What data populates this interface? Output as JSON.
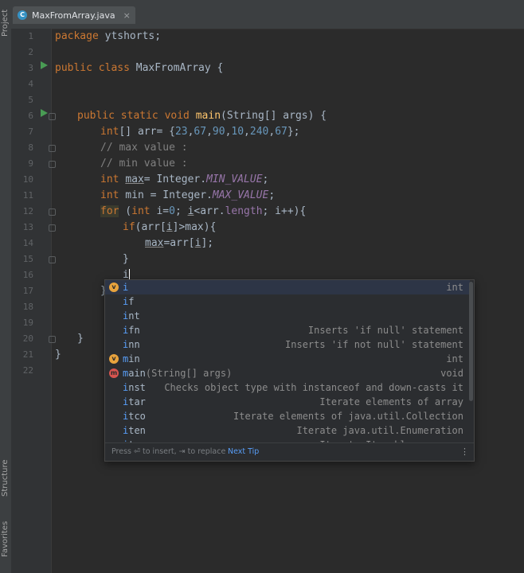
{
  "side_tools": {
    "project": "Project",
    "structure": "Structure",
    "favorites": "Favorites"
  },
  "tab": {
    "icon_letter": "C",
    "title": "MaxFromArray.java",
    "close": "×"
  },
  "line_numbers": [
    "1",
    "2",
    "3",
    "4",
    "5",
    "6",
    "7",
    "8",
    "9",
    "10",
    "11",
    "12",
    "13",
    "14",
    "15",
    "16",
    "17",
    "18",
    "19",
    "20",
    "21",
    "22"
  ],
  "code": {
    "l1_kw": "package",
    "l1_rest": " ytshorts;",
    "l3_kw": "public class",
    "l3_rest": " MaxFromArray {",
    "l6_kw": "public static void",
    "l6_fn": " main",
    "l6_rest": "(String[] args) {",
    "l7_kw": "int",
    "l7_a": "[] arr= {",
    "l7_n1": "23",
    "c": ",",
    "l7_n2": "67",
    "l7_n3": "90",
    "l7_n4": "10",
    "l7_n5": "240",
    "l7_n6": "67",
    "l7_end": "};",
    "l8": "// max value :",
    "l9": "// min value :",
    "l10_kw": "int",
    "l10_var": "max",
    "l10_a": "= Integer.",
    "l10_fld": "MIN_VALUE",
    "l10_end": ";",
    "l11_kw": "int",
    "l11_a": " min = Integer.",
    "l11_fld": "MAX_VALUE",
    "l11_end": ";",
    "l12_kw": "for",
    "l12_a": " (",
    "l12_kw2": "int",
    "l12_b": " i=",
    "l12_n": "0",
    "l12_c": "; ",
    "l12_i": "i",
    "l12_d": "<arr.",
    "l12_len": "length",
    "l12_e": "; i++){",
    "l13_kw": "if",
    "l13_a": "(arr[",
    "l13_i": "i",
    "l13_b": "]>max){",
    "l14_var": "max",
    "l14_a": "=arr[",
    "l14_i": "i",
    "l14_b": "];",
    "l15": "}",
    "l16": "i",
    "l17": "}",
    "l20": "}",
    "l21": "}"
  },
  "completion": {
    "items": [
      {
        "icon": "v",
        "icon_color": "#e8a33d",
        "match": "i",
        "rest": "",
        "params": "",
        "detail": "int"
      },
      {
        "icon": "",
        "icon_color": "",
        "match": "i",
        "rest": "f",
        "params": "",
        "detail": ""
      },
      {
        "icon": "",
        "icon_color": "",
        "match": "i",
        "rest": "nt",
        "params": "",
        "detail": ""
      },
      {
        "icon": "",
        "icon_color": "",
        "match": "i",
        "rest": "fn",
        "params": "",
        "detail": "Inserts 'if null' statement"
      },
      {
        "icon": "",
        "icon_color": "",
        "match": "i",
        "rest": "nn",
        "params": "",
        "detail": "Inserts 'if not null' statement"
      },
      {
        "icon": "v",
        "icon_color": "#e8a33d",
        "match": "m",
        "rest": "in",
        "params": "",
        "detail": "int"
      },
      {
        "icon": "m",
        "icon_color": "#d6544f",
        "match": "m",
        "rest": "ain",
        "params": "(String[] args)",
        "detail": "void"
      },
      {
        "icon": "",
        "icon_color": "",
        "match": "i",
        "rest": "nst",
        "params": "",
        "detail": "Checks object type with instanceof and down-casts it"
      },
      {
        "icon": "",
        "icon_color": "",
        "match": "i",
        "rest": "tar",
        "params": "",
        "detail": "Iterate elements of array"
      },
      {
        "icon": "",
        "icon_color": "",
        "match": "i",
        "rest": "tco",
        "params": "",
        "detail": "Iterate elements of java.util.Collection"
      },
      {
        "icon": "",
        "icon_color": "",
        "match": "i",
        "rest": "ten",
        "params": "",
        "detail": "Iterate java.util.Enumeration"
      },
      {
        "icon": "",
        "icon_color": "",
        "match": "i",
        "rest": "ter",
        "params": "",
        "detail": "Iterate Iterable or array"
      }
    ],
    "footer_hint": "Press ⏎ to insert, ⇥ to replace",
    "footer_tip": "Next Tip",
    "footer_menu": "⋮"
  }
}
